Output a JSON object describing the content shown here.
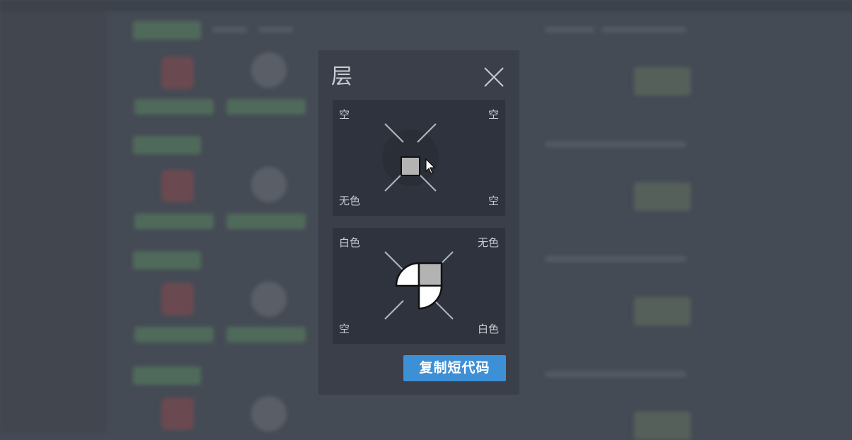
{
  "dialog": {
    "title": "层",
    "close_icon": "close-icon",
    "copy_button_label": "复制短代码"
  },
  "panel_one": {
    "top_left": "空",
    "top_right": "空",
    "bottom_left": "无色",
    "bottom_right": "空",
    "center": {
      "shape": "square",
      "fill": "#b3b3b3"
    }
  },
  "panel_two": {
    "top_left": "白色",
    "top_right": "无色",
    "bottom_left": "空",
    "bottom_right": "白色",
    "quadrants": {
      "top_left": "#ffffff",
      "top_right": "#b3b3b3",
      "bottom_left": "none",
      "bottom_right": "#ffffff"
    }
  },
  "colors": {
    "overlay_bg": "#454b55",
    "dialog_bg": "#3a3f4a",
    "panel_bg": "#2e333d",
    "accent": "#3d8fd6"
  }
}
